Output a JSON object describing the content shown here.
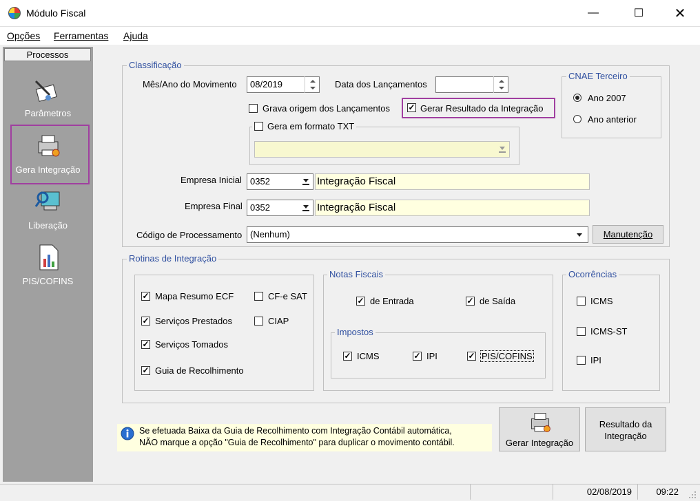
{
  "window": {
    "title": "Módulo Fiscal"
  },
  "menu": [
    "Opções",
    "Ferramentas",
    "Ajuda"
  ],
  "sidebar": {
    "header": "Processos",
    "items": [
      {
        "label": "Parâmetros"
      },
      {
        "label": "Gera Integração"
      },
      {
        "label": "Liberação"
      },
      {
        "label": "PIS/COFINS"
      }
    ]
  },
  "classificacao": {
    "legend": "Classificação",
    "mes_ano_label": "Mês/Ano do Movimento",
    "mes_ano_value": "08/2019",
    "data_lanc_label": "Data dos Lançamentos",
    "data_lanc_value": "",
    "grava_origem": {
      "label": "Grava origem dos Lançamentos",
      "checked": false
    },
    "gerar_resultado": {
      "label": "Gerar Resultado da Integração",
      "checked": true
    },
    "gera_txt": {
      "label": "Gera em formato TXT",
      "checked": false
    },
    "txt_path": "",
    "empresa_inicial_label": "Empresa Inicial",
    "empresa_inicial_code": "0352",
    "empresa_inicial_name": "Integração Fiscal",
    "empresa_final_label": "Empresa Final",
    "empresa_final_code": "0352",
    "empresa_final_name": "Integração Fiscal",
    "codigo_proc_label": "Código de Processamento",
    "codigo_proc_value": "(Nenhum)",
    "manutencao_label": "Manutenção"
  },
  "cnae": {
    "legend": "CNAE Terceiro",
    "options": [
      {
        "label": "Ano 2007",
        "selected": true
      },
      {
        "label": "Ano anterior",
        "selected": false
      }
    ]
  },
  "rotinas": {
    "legend": "Rotinas de Integração",
    "items": [
      {
        "label": "Mapa Resumo ECF",
        "checked": true
      },
      {
        "label": "Serviços Prestados",
        "checked": true
      },
      {
        "label": "Serviços Tomados",
        "checked": true
      },
      {
        "label": "Guia de Recolhimento",
        "checked": true
      },
      {
        "label": "CF-e SAT",
        "checked": false
      },
      {
        "label": "CIAP",
        "checked": false
      }
    ]
  },
  "notas": {
    "legend": "Notas Fiscais",
    "entrada": {
      "label": "de Entrada",
      "checked": true
    },
    "saida": {
      "label": "de Saída",
      "checked": true
    },
    "impostos_legend": "Impostos",
    "impostos": [
      {
        "label": "ICMS",
        "checked": true
      },
      {
        "label": "IPI",
        "checked": true
      },
      {
        "label": "PIS/COFINS",
        "checked": true
      }
    ]
  },
  "ocorrencias": {
    "legend": "Ocorrências",
    "items": [
      {
        "label": "ICMS",
        "checked": false
      },
      {
        "label": "ICMS-ST",
        "checked": false
      },
      {
        "label": "IPI",
        "checked": false
      }
    ]
  },
  "info": {
    "line1": "Se efetuada Baixa da Guia de Recolhimento com Integração Contábil automática,",
    "line2": "NÃO marque a opção \"Guia de Recolhimento\" para duplicar o movimento contábil."
  },
  "buttons": {
    "gerar": "Gerar Integração",
    "resultado_l1": "Resultado da",
    "resultado_l2": "Integração"
  },
  "status": {
    "date": "02/08/2019",
    "time": "09:22"
  }
}
